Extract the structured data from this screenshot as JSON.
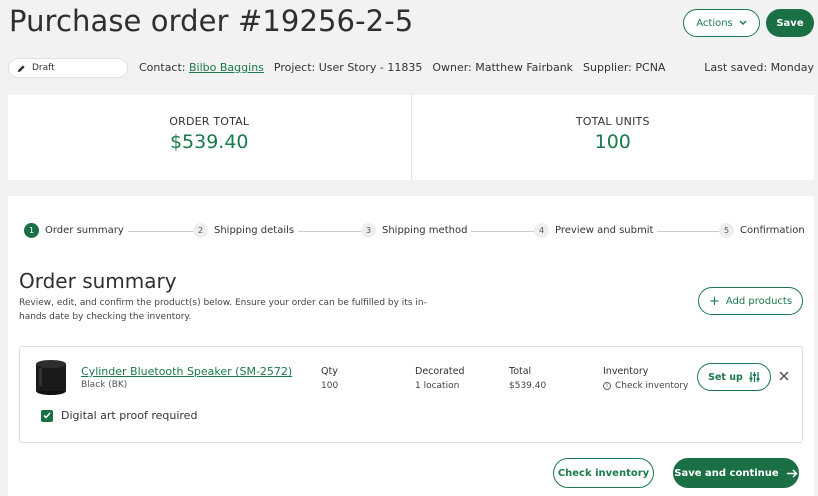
{
  "header": {
    "title": "Purchase order #19256-2-5",
    "actions_label": "Actions",
    "save_label": "Save"
  },
  "meta": {
    "status": "Draft",
    "contact_label": "Contact:",
    "contact_value": "Bilbo Baggins",
    "project": "Project: User Story - 11835",
    "owner": "Owner: Matthew Fairbank",
    "supplier": "Supplier: PCNA",
    "last_saved": "Last saved: Monday"
  },
  "stats": {
    "order_total_label": "ORDER TOTAL",
    "order_total_value": "$539.40",
    "total_units_label": "TOTAL UNITS",
    "total_units_value": "100"
  },
  "stepper": {
    "steps": [
      {
        "num": "1",
        "label": "Order summary",
        "active": true
      },
      {
        "num": "2",
        "label": "Shipping details",
        "active": false
      },
      {
        "num": "3",
        "label": "Shipping method",
        "active": false
      },
      {
        "num": "4",
        "label": "Preview and submit",
        "active": false
      },
      {
        "num": "5",
        "label": "Confirmation",
        "active": false
      }
    ]
  },
  "summary": {
    "title": "Order summary",
    "description": "Review, edit, and confirm the product(s) below. Ensure your order can be fulfilled by its in-hands date by checking the inventory.",
    "add_products_label": "Add products"
  },
  "product": {
    "name": "Cylinder Bluetooth Speaker (SM-2572)",
    "variant": "Black (BK)",
    "qty_label": "Qty",
    "qty_value": "100",
    "decorated_label": "Decorated",
    "decorated_value": "1 location",
    "total_label": "Total",
    "total_value": "$539.40",
    "inventory_label": "Inventory",
    "inventory_value": "Check inventory",
    "setup_label": "Set up",
    "proof_label": "Digital art proof required",
    "proof_checked": true
  },
  "footer": {
    "check_inventory_label": "Check inventory",
    "continue_label": "Save and continue"
  },
  "colors": {
    "accent": "#1b6f45",
    "accent_text": "#1b7a4c",
    "background": "#f2f2f2"
  }
}
